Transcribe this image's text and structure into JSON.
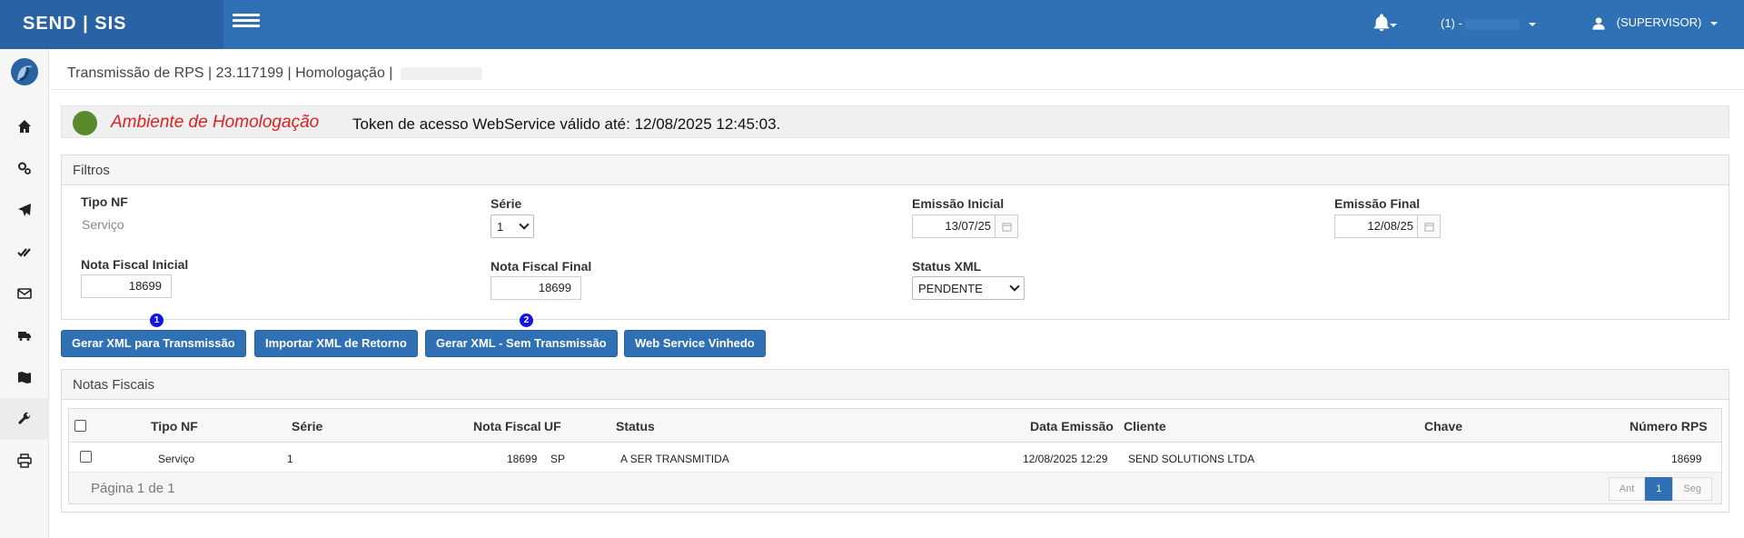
{
  "header": {
    "brand": "SEND | SIS",
    "company_label": "(1) -",
    "user_label": "(SUPERVISOR)"
  },
  "sidebar": {
    "items": [
      {
        "icon": "home-icon"
      },
      {
        "icon": "cogs-icon"
      },
      {
        "icon": "paper-plane-icon"
      },
      {
        "icon": "double-check-icon"
      },
      {
        "icon": "envelope-icon"
      },
      {
        "icon": "truck-icon"
      },
      {
        "icon": "map-icon"
      },
      {
        "icon": "wrench-icon"
      },
      {
        "icon": "print-icon"
      }
    ]
  },
  "breadcrumb": {
    "text": "Transmissão de RPS | 23.117199 | Homologação |"
  },
  "environment": {
    "name": "Ambiente de Homologação",
    "token_text": "Token de acesso WebService válido até: 12/08/2025 12:45:03.",
    "status_color": "#5a8a2e"
  },
  "filters": {
    "title": "Filtros",
    "tipo_nf_label": "Tipo NF",
    "tipo_nf_value": "Serviço",
    "serie_label": "Série",
    "serie_value": "1",
    "emissao_inicial_label": "Emissão Inicial",
    "emissao_inicial_value": "13/07/25",
    "emissao_final_label": "Emissão Final",
    "emissao_final_value": "12/08/25",
    "nf_inicial_label": "Nota Fiscal Inicial",
    "nf_inicial_value": "18699",
    "nf_final_label": "Nota Fiscal Final",
    "nf_final_value": "18699",
    "status_xml_label": "Status XML",
    "status_xml_value": "PENDENTE"
  },
  "actions": {
    "gerar_xml": "Gerar XML para Transmissão",
    "importar_xml": "Importar XML de Retorno",
    "gerar_sem": "Gerar XML - Sem Transmissão",
    "web_service": "Web Service Vinhedo",
    "badge_1": "1",
    "badge_2": "2"
  },
  "notas": {
    "title": "Notas Fiscais",
    "columns": {
      "tipo": "Tipo NF",
      "serie": "Série",
      "nota": "Nota Fiscal",
      "uf": "UF",
      "status": "Status",
      "data": "Data Emissão",
      "cliente": "Cliente",
      "chave": "Chave",
      "rps": "Número RPS"
    },
    "rows": [
      {
        "tipo": "Serviço",
        "serie": "1",
        "nota": "18699",
        "uf": "SP",
        "status": "A SER TRANSMITIDA",
        "data": "12/08/2025 12:29",
        "cliente": "SEND SOLUTIONS LTDA",
        "chave": "",
        "rps": "18699"
      }
    ],
    "page_info": "Página 1 de 1",
    "pager": {
      "prev": "Ant",
      "current": "1",
      "next": "Seg"
    }
  }
}
